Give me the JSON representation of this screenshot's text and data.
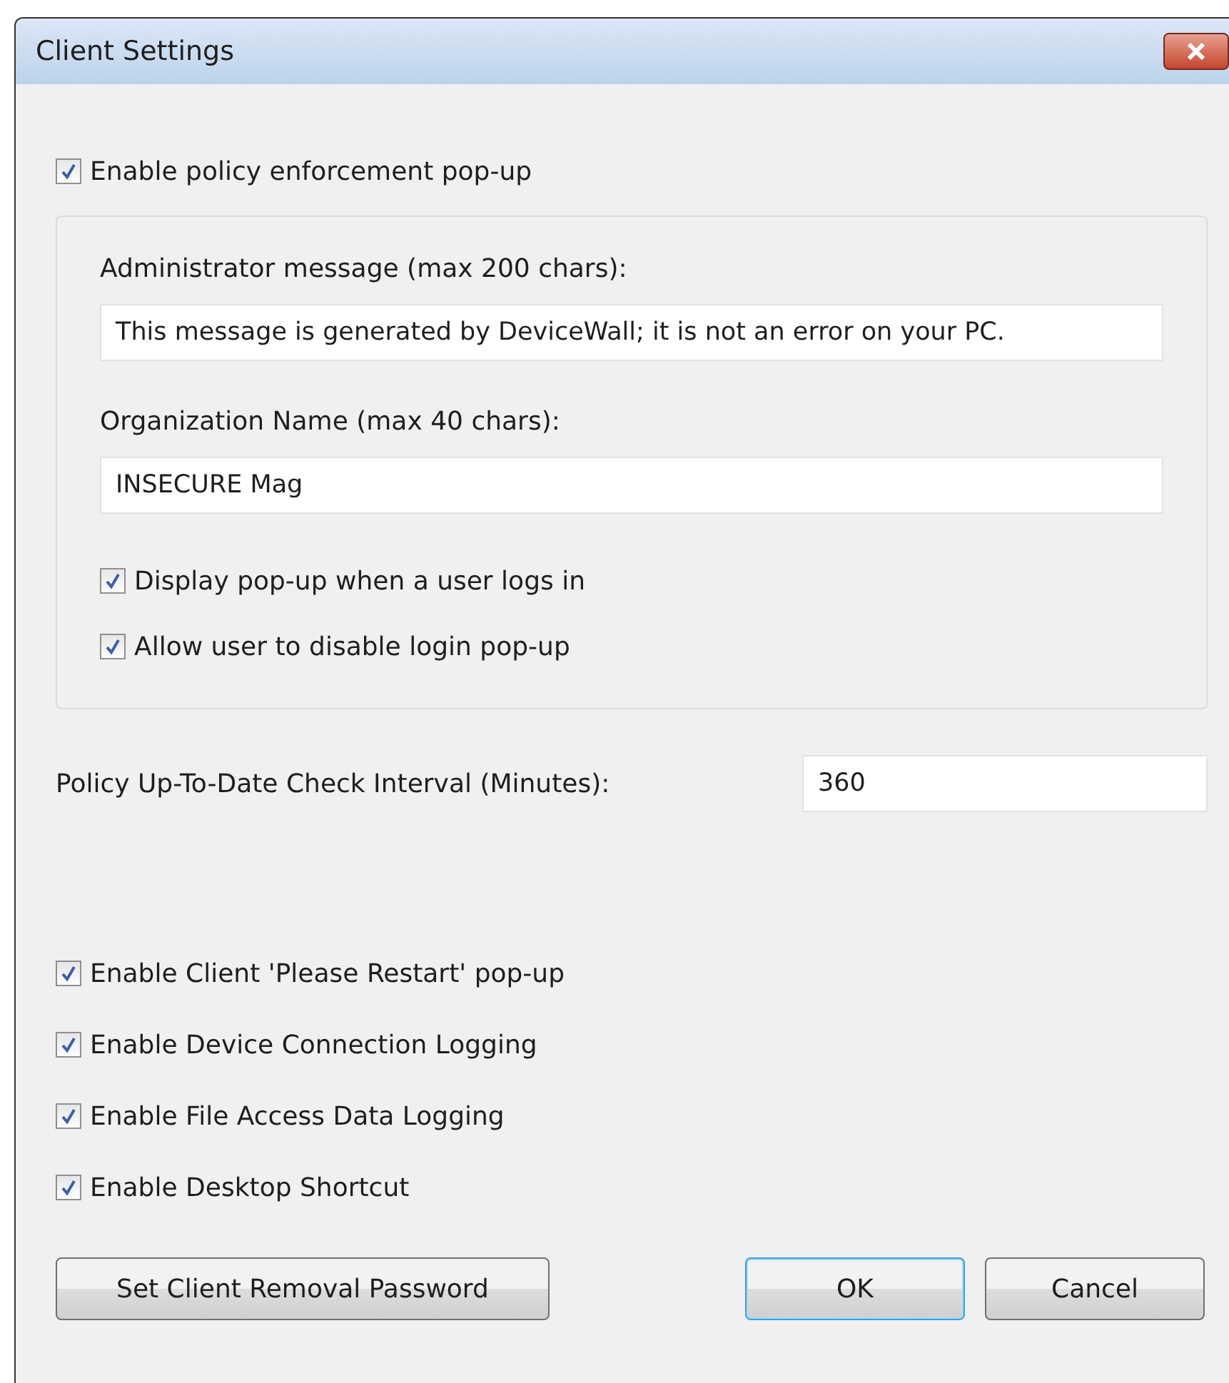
{
  "window": {
    "title": "Client Settings"
  },
  "policy_popup": {
    "label": "Enable policy enforcement pop-up",
    "checked": true
  },
  "group": {
    "admin_message": {
      "label": "Administrator message (max 200 chars):",
      "value": "This message is generated by DeviceWall; it is not an error on your PC."
    },
    "organization": {
      "label": "Organization Name (max 40 chars):",
      "value": "INSECURE Mag"
    },
    "options": [
      {
        "label": "Display pop-up when a user logs in",
        "checked": true
      },
      {
        "label": "Allow user to disable login pop-up",
        "checked": true
      }
    ]
  },
  "interval": {
    "label": "Policy Up-To-Date Check Interval (Minutes):",
    "value": "360"
  },
  "options": [
    {
      "label": "Enable Client 'Please Restart' pop-up",
      "checked": true
    },
    {
      "label": "Enable Device Connection Logging",
      "checked": true
    },
    {
      "label": "Enable File Access Data Logging",
      "checked": true
    },
    {
      "label": "Enable Desktop Shortcut",
      "checked": true
    }
  ],
  "buttons": [
    {
      "label": "Set Client Removal Password",
      "kind": "normal"
    },
    {
      "label": "OK",
      "kind": "default"
    },
    {
      "label": "Cancel",
      "kind": "normal"
    }
  ]
}
